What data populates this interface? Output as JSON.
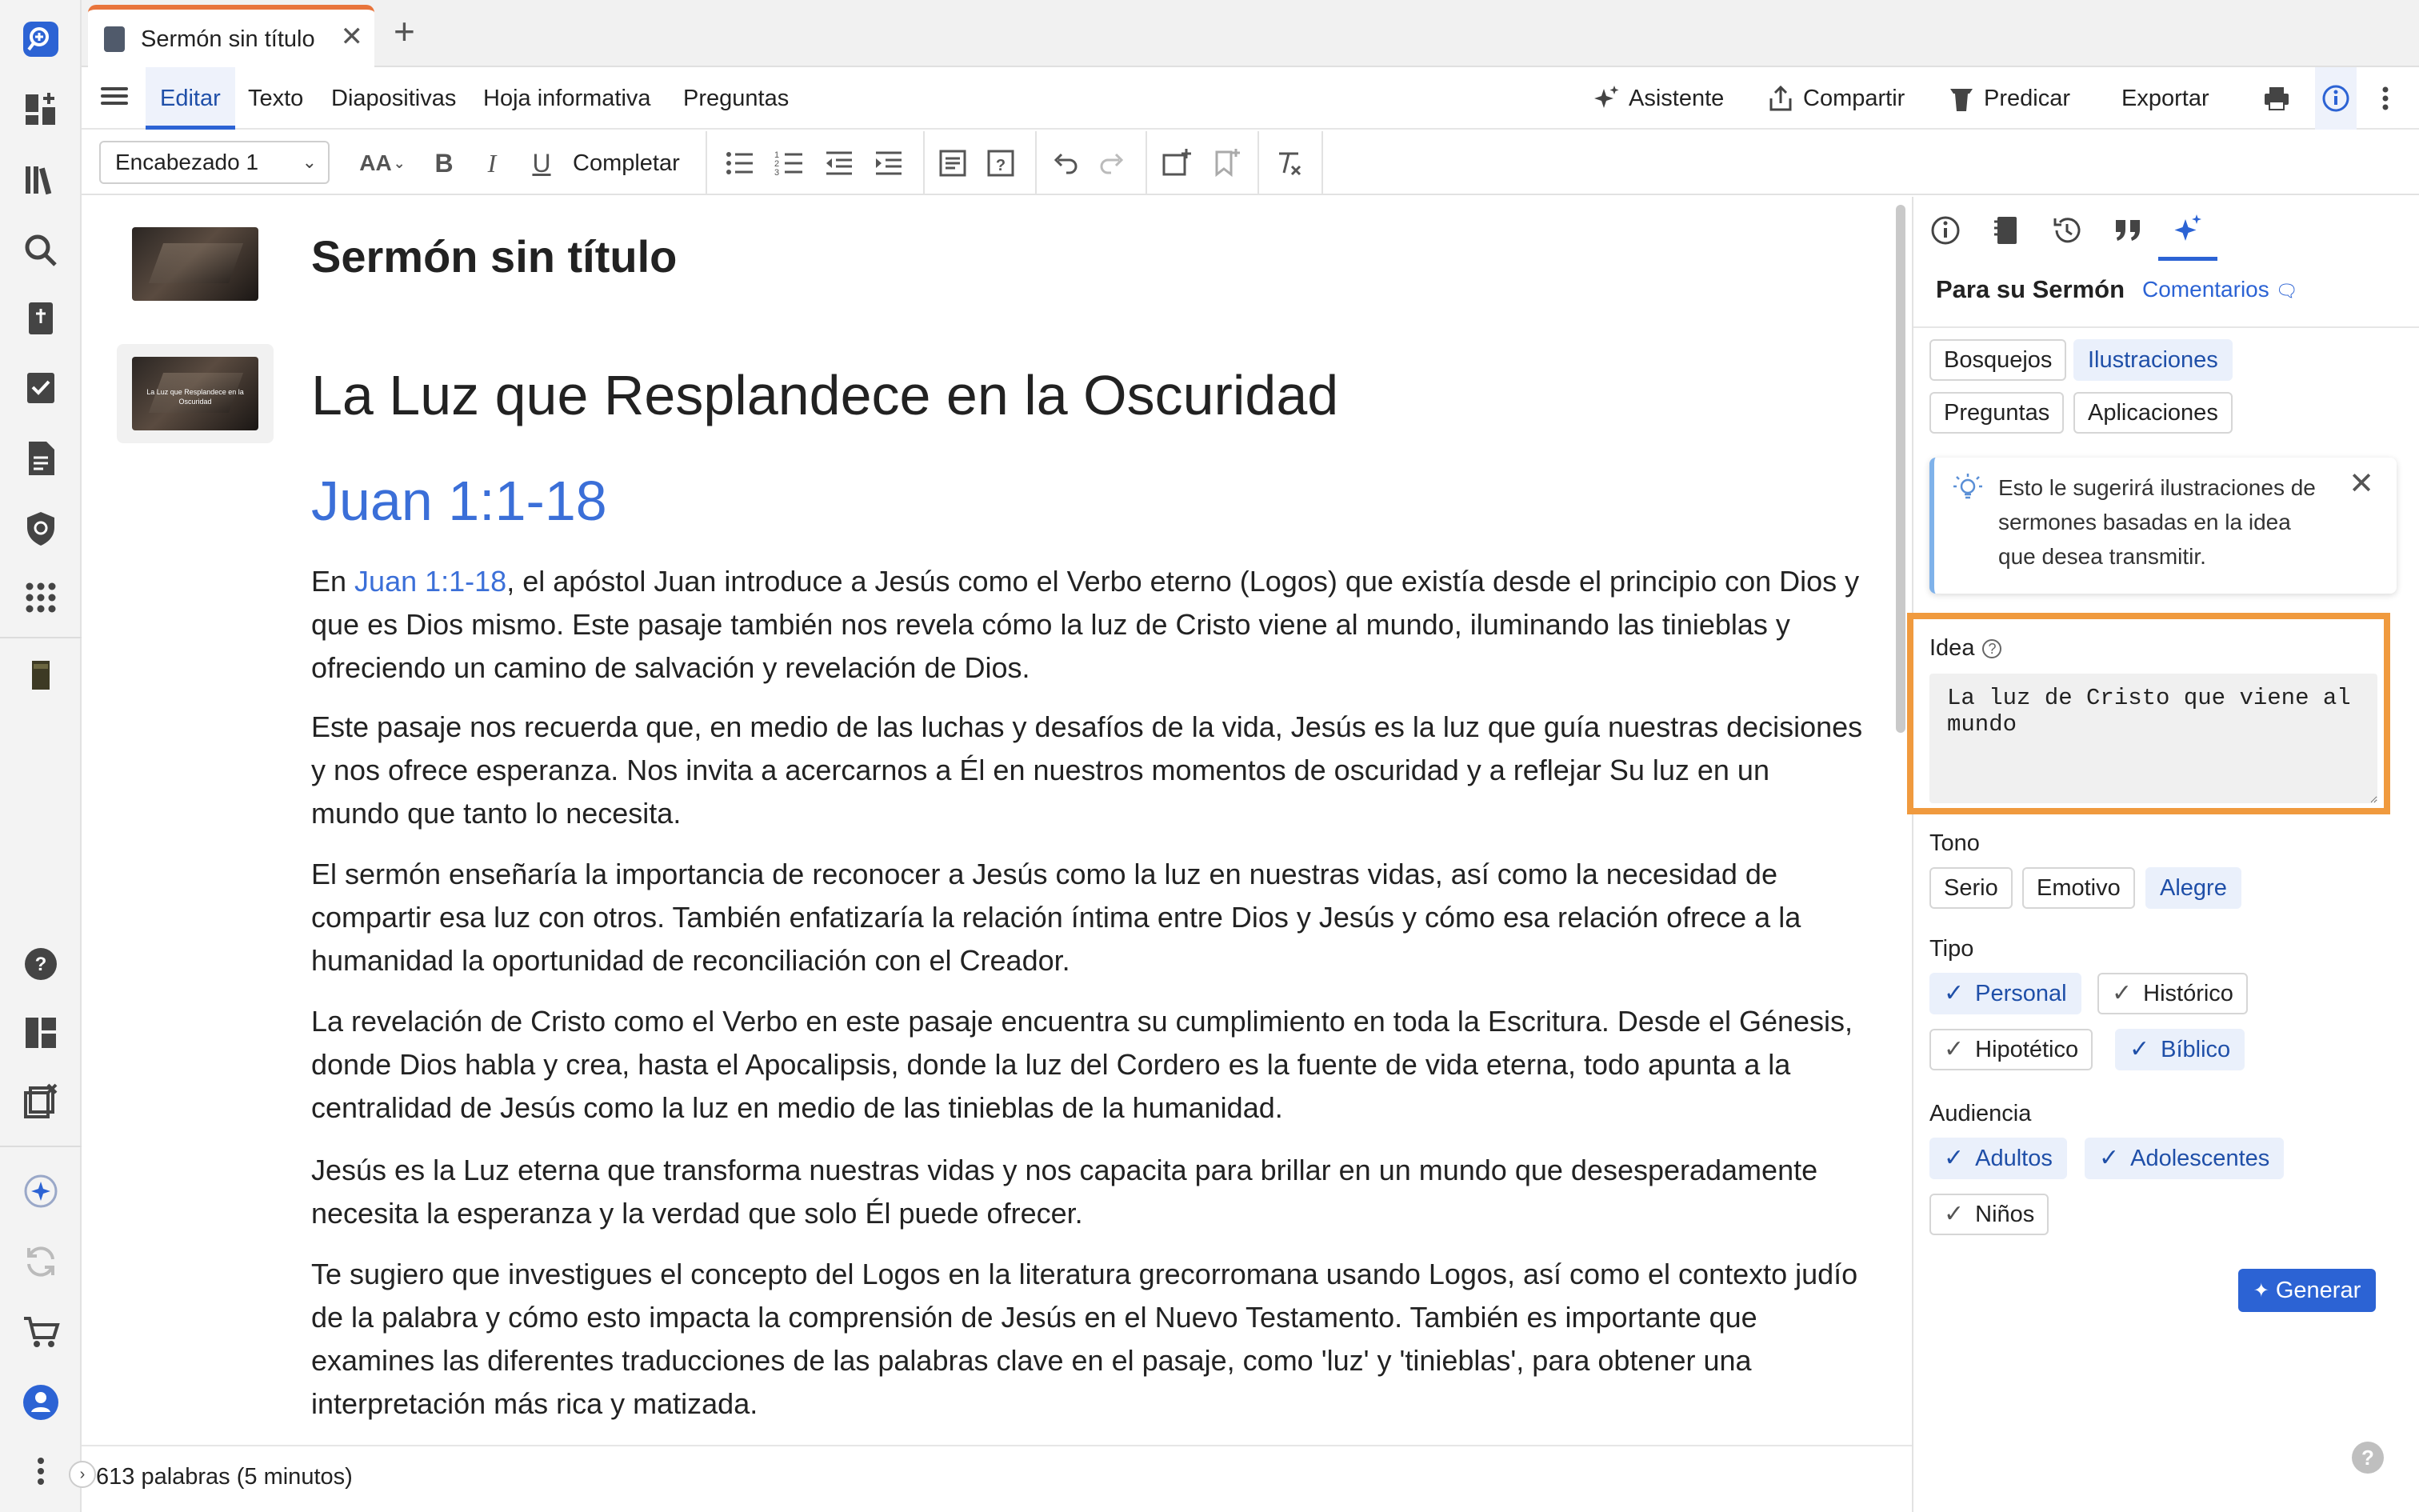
{
  "tab": {
    "title": "Sermón sin título"
  },
  "menu": {
    "items": [
      "Editar",
      "Texto",
      "Diapositivas",
      "Hoja informativa",
      "Preguntas"
    ],
    "right": {
      "assistant": "Asistente",
      "share": "Compartir",
      "preach": "Predicar",
      "export": "Exportar"
    }
  },
  "format": {
    "style_select": "Encabezado 1",
    "complete": "Completar",
    "font_size": "AA"
  },
  "doc": {
    "title": "Sermón sin título",
    "slide_caption": "La Luz que Resplandece en la Oscuridad",
    "heading": "La Luz que Resplandece en la Oscuridad",
    "reference": "Juan 1:1-18",
    "p1_pre": "En ",
    "p1_link": "Juan 1:1-18",
    "p1_post": ", el apóstol Juan introduce a Jesús como el Verbo eterno (Logos) que existía desde el principio con Dios y que es Dios mismo. Este pasaje también nos revela cómo la luz de Cristo viene al mundo, iluminando las tinieblas y ofreciendo un camino de salvación y revelación de Dios.",
    "p2": "Este pasaje nos recuerda que, en medio de las luchas y desafíos de la vida, Jesús es la luz que guía nuestras decisiones y nos ofrece esperanza. Nos invita a acercarnos a Él en nuestros momentos de oscuridad y a reflejar Su luz en un mundo que tanto lo necesita.",
    "p3": "El sermón enseñaría la importancia de reconocer a Jesús como la luz en nuestras vidas, así como la necesidad de compartir esa luz con otros. También enfatizaría la relación íntima entre Dios y Jesús y cómo esa relación ofrece a la humanidad la oportunidad de reconciliación con el Creador.",
    "p4": "La revelación de Cristo como el Verbo en este pasaje encuentra su cumplimiento en toda la Escritura. Desde el Génesis, donde Dios habla y crea, hasta el Apocalipsis, donde la luz del Cordero es la fuente de vida eterna, todo apunta a la centralidad de Jesús como la luz en medio de las tinieblas de la humanidad.",
    "p5": "Jesús es la Luz eterna que transforma nuestras vidas y nos capacita para brillar en un mundo que desesperadamente necesita la esperanza y la verdad que solo Él puede ofrecer.",
    "p6": "Te sugiero que investigues el concepto del Logos en la literatura grecorromana usando Logos, así como el contexto judío de la palabra y cómo esto impacta la comprensión de Jesús en el Nuevo Testamento. También es importante que examines las diferentes traducciones de las palabras clave en el pasaje, como 'luz' y 'tinieblas', para obtener una interpretación más rica y matizada."
  },
  "status": {
    "words": "613 palabras (5 minutos)"
  },
  "panel": {
    "heading": "Para su Sermón",
    "feedback": "Comentarios",
    "categories": [
      "Bosquejos",
      "Ilustraciones",
      "Preguntas",
      "Aplicaciones"
    ],
    "selected_category": "Ilustraciones",
    "info_text": "Esto le sugerirá ilustraciones de sermones basadas en la idea que desea transmitir.",
    "idea_label": "Idea",
    "idea_value": "La luz de Cristo que viene al mundo",
    "tone_label": "Tono",
    "tones": [
      "Serio",
      "Emotivo",
      "Alegre"
    ],
    "selected_tone": "Alegre",
    "type_label": "Tipo",
    "types": [
      {
        "label": "Personal",
        "checked": true,
        "highlight": true
      },
      {
        "label": "Histórico",
        "checked": true,
        "highlight": false
      },
      {
        "label": "Hipotético",
        "checked": true,
        "highlight": false
      },
      {
        "label": "Bíblico",
        "checked": true,
        "highlight": true
      }
    ],
    "audience_label": "Audiencia",
    "audiences": [
      {
        "label": "Adultos",
        "checked": true,
        "highlight": true
      },
      {
        "label": "Adolescentes",
        "checked": true,
        "highlight": true
      },
      {
        "label": "Niños",
        "checked": true,
        "highlight": false
      }
    ],
    "generate": "Generar"
  },
  "colors": {
    "accent": "#2c63d4",
    "link": "#3b6fd8",
    "tab_top": "#e8743b",
    "highlight_border": "#f09a3e"
  }
}
